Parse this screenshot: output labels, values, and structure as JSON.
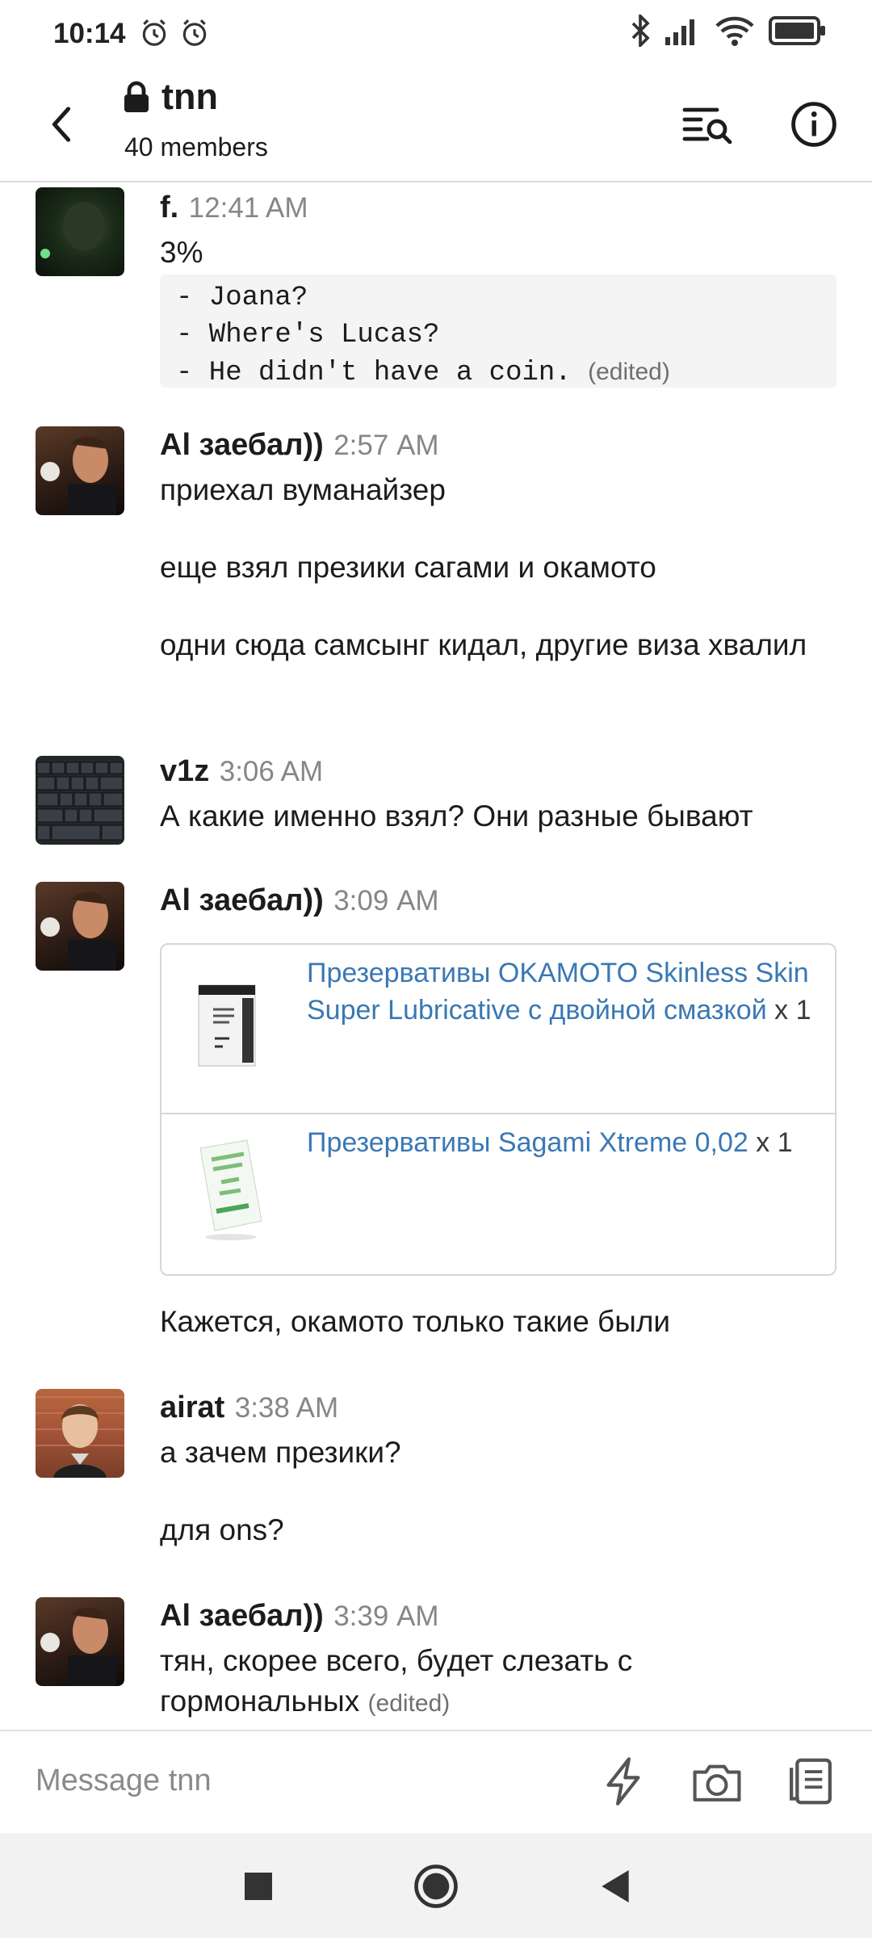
{
  "status_bar": {
    "time": "10:14",
    "icons": [
      "alarm-icon",
      "alarm-icon",
      "bluetooth-icon",
      "signal-icon",
      "wifi-icon",
      "battery-icon"
    ]
  },
  "header": {
    "channel_name": "tnn",
    "members": "40 members",
    "icons": [
      "back-arrow-icon",
      "lock-icon",
      "search-in-channel-icon",
      "info-icon"
    ]
  },
  "messages": [
    {
      "author": "f.",
      "time": "12:41 AM",
      "text": "3%",
      "code_lines": [
        "- Joana?",
        "- Where's Lucas?",
        "- He didn't have a coin."
      ],
      "edited": "(edited)"
    },
    {
      "author": "Al заебал))",
      "time": "2:57 AM",
      "paragraphs": [
        "приехал вуманайзер",
        "еще взял презики сагами и окамото",
        "одни сюда самсынг кидал, другие виза хвалил"
      ]
    },
    {
      "author": "v1z",
      "time": "3:06 AM",
      "text": "А какие именно взял? Они разные бывают"
    },
    {
      "author": "Al заебал))",
      "time": "3:09 AM",
      "products": [
        {
          "name": "Презервативы OKAMOTO Skinless Skin Super Lubricative с двойной смазкой",
          "qty": "x 1"
        },
        {
          "name": "Презервативы Sagami Xtreme 0,02",
          "qty": "x 1"
        }
      ],
      "text": "Кажется, окамото только такие были"
    },
    {
      "author": "airat",
      "time": "3:38 AM",
      "paragraphs": [
        "а зачем презики?",
        "для ons?"
      ]
    },
    {
      "author": "Al заебал))",
      "time": "3:39 AM",
      "text": "тян, скорее всего, будет слезать с гормональных",
      "edited": "(edited)"
    }
  ],
  "composer": {
    "placeholder": "Message tnn",
    "icons": [
      "shortcut-lightning-icon",
      "camera-icon",
      "attachment-icon"
    ]
  },
  "nav_bar": {
    "icons": [
      "recents-square-icon",
      "home-circle-icon",
      "back-triangle-icon"
    ]
  },
  "colors": {
    "link": "#3a78b4",
    "timestamp": "#868686",
    "code_bg": "#f4f4f4"
  }
}
